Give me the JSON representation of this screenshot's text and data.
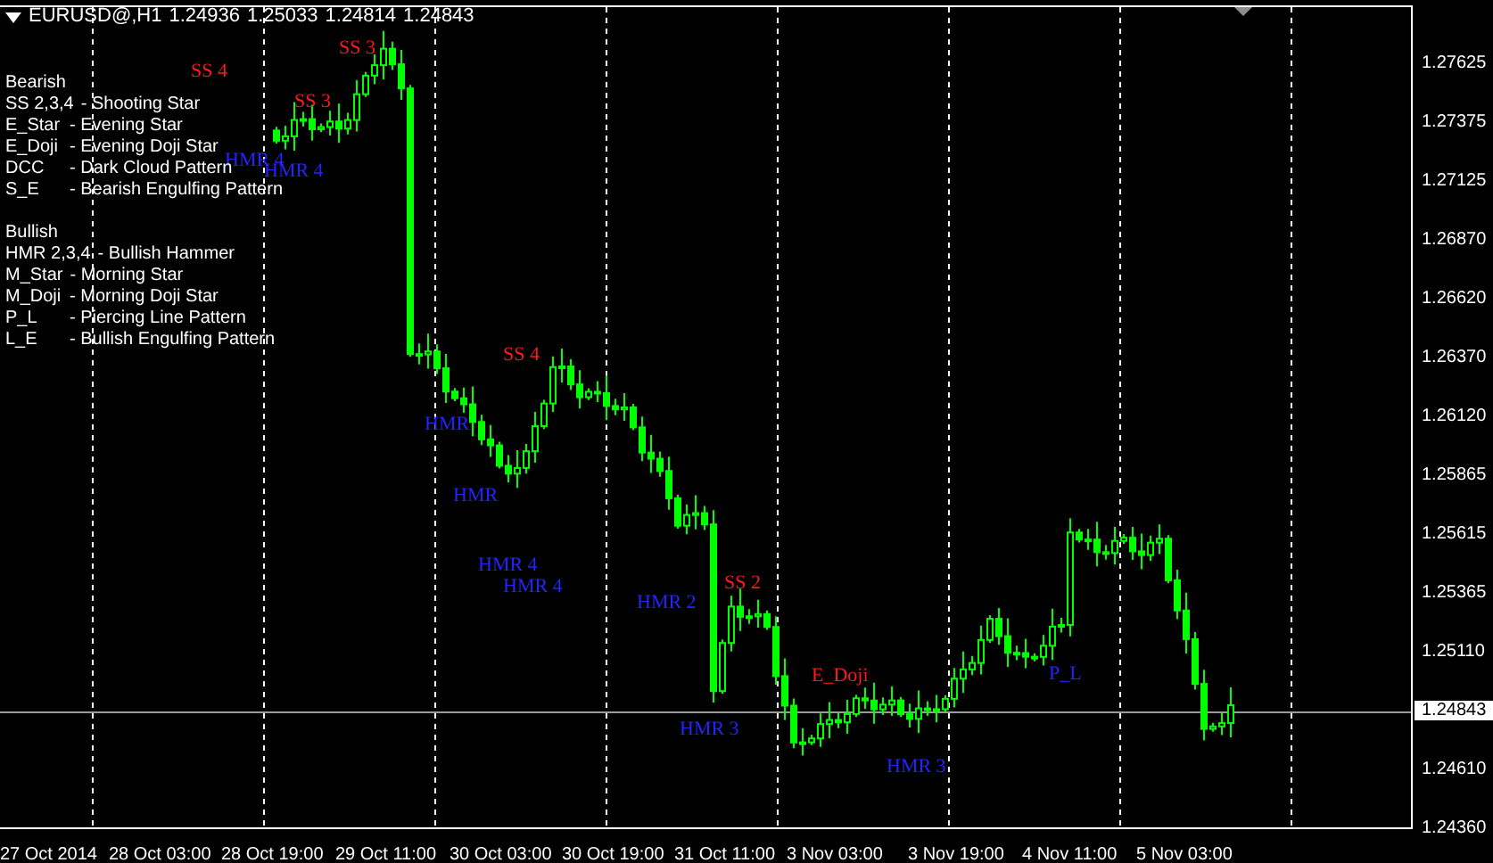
{
  "header": {
    "symbol": "EURUSD@,H1",
    "prices": [
      "1.24936",
      "1.25033",
      "1.24814",
      "1.24843"
    ]
  },
  "legend": [
    {
      "heading": "Bearish",
      "items": [
        {
          "code": "SS 2,3,4",
          "description": "- Shooting Star"
        },
        {
          "code": "E_Star",
          "description": "- Evening Star"
        },
        {
          "code": "E_Doji",
          "description": "- Evening Doji Star"
        },
        {
          "code": "DCC",
          "description": "- Dark Cloud Pattern"
        },
        {
          "code": "S_E",
          "description": "- Bearish Engulfing Pattern"
        }
      ]
    },
    {
      "heading": "Bullish",
      "items": [
        {
          "code": "HMR 2,3,4",
          "description": "- Bullish Hammer"
        },
        {
          "code": "M_Star",
          "description": "- Morning Star"
        },
        {
          "code": "M_Doji",
          "description": "- Morning Doji Star"
        },
        {
          "code": "P_L",
          "description": "- Piercing Line Pattern"
        },
        {
          "code": "L_E",
          "description": "- Bullish Engulfing Pattern"
        }
      ]
    }
  ],
  "pattern_labels": [
    {
      "text": "SS 4",
      "kind": "bearish"
    },
    {
      "text": "SS 3",
      "kind": "bearish"
    },
    {
      "text": "SS 3",
      "kind": "bearish"
    },
    {
      "text": "HMR 4",
      "kind": "bullish"
    },
    {
      "text": "HMR 4",
      "kind": "bullish"
    },
    {
      "text": "HMR",
      "kind": "bullish"
    },
    {
      "text": "SS 4",
      "kind": "bearish"
    },
    {
      "text": "HMR",
      "kind": "bullish"
    },
    {
      "text": "HMR 4",
      "kind": "bullish"
    },
    {
      "text": "HMR 4",
      "kind": "bullish"
    },
    {
      "text": "HMR 2",
      "kind": "bullish"
    },
    {
      "text": "SS 2",
      "kind": "bearish"
    },
    {
      "text": "HMR 3",
      "kind": "bullish"
    },
    {
      "text": "E_Doji",
      "kind": "bearish"
    },
    {
      "text": "HMR 3",
      "kind": "bullish"
    },
    {
      "text": "P_L",
      "kind": "bullish"
    }
  ],
  "price_axis": {
    "ticks": [
      "1.27625",
      "1.27375",
      "1.27125",
      "1.26870",
      "1.26620",
      "1.26370",
      "1.26120",
      "1.25865",
      "1.25615",
      "1.25365",
      "1.25110",
      "1.24610",
      "1.24360"
    ],
    "current_price": "1.24843"
  },
  "time_axis": {
    "labels": [
      "27 Oct 2014",
      "28 Oct 03:00",
      "28 Oct 19:00",
      "29 Oct 11:00",
      "30 Oct 03:00",
      "30 Oct 19:00",
      "31 Oct 11:00",
      "3 Nov 03:00",
      "3 Nov 19:00",
      "4 Nov 11:00",
      "5 Nov 03:00"
    ]
  }
}
